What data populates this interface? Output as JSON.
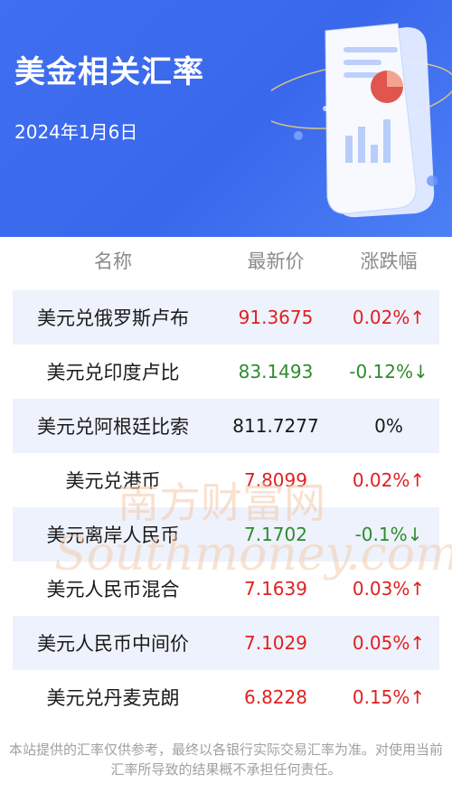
{
  "header": {
    "title": "美金相关汇率",
    "date": "2024年1月6日"
  },
  "table": {
    "columns": [
      "名称",
      "最新价",
      "涨跌幅"
    ],
    "rows": [
      {
        "name": "美元兑俄罗斯卢布",
        "price": "91.3675",
        "change": "0.02%↑",
        "trend": "up"
      },
      {
        "name": "美元兑印度卢比",
        "price": "83.1493",
        "change": "-0.12%↓",
        "trend": "down"
      },
      {
        "name": "美元兑阿根廷比索",
        "price": "811.7277",
        "change": "0%",
        "trend": "flat"
      },
      {
        "name": "美元兑港币",
        "price": "7.8099",
        "change": "0.02%↑",
        "trend": "up"
      },
      {
        "name": "美元离岸人民币",
        "price": "7.1702",
        "change": "-0.1%↓",
        "trend": "down"
      },
      {
        "name": "美元人民币混合",
        "price": "7.1639",
        "change": "0.03%↑",
        "trend": "up"
      },
      {
        "name": "美元人民币中间价",
        "price": "7.1029",
        "change": "0.05%↑",
        "trend": "up"
      },
      {
        "name": "美元兑丹麦克朗",
        "price": "6.8228",
        "change": "0.15%↑",
        "trend": "up"
      }
    ]
  },
  "watermark": {
    "cn": "南方财富网",
    "en": "Southmoney.com"
  },
  "footer": {
    "disclaimer": "本站提供的汇率仅供参考，最终以各银行实际交易汇率为准。对使用当前汇率所导致的结果概不承担任何责任。"
  },
  "colors": {
    "header_bg": "#3f6ef0",
    "up": "#e02020",
    "down": "#2e8b2e",
    "row_shade": "#eef2fc"
  }
}
